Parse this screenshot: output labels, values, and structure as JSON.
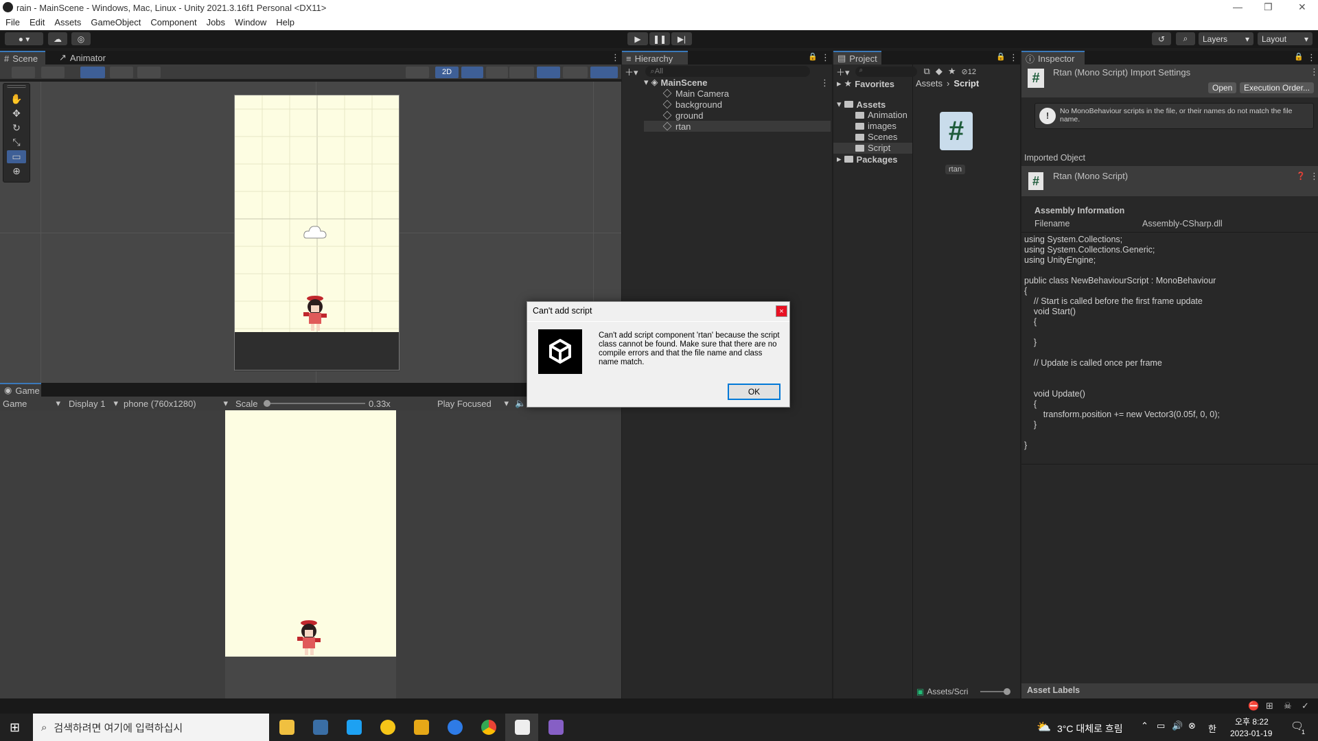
{
  "window": {
    "title": "rain - MainScene - Windows, Mac, Linux - Unity 2021.3.16f1 Personal <DX11>"
  },
  "menu": [
    "File",
    "Edit",
    "Assets",
    "GameObject",
    "Component",
    "Jobs",
    "Window",
    "Help"
  ],
  "toolbar": {
    "layers_label": "Layers",
    "layout_label": "Layout"
  },
  "scene": {
    "tab_scene": "Scene",
    "tab_animator": "Animator",
    "mode_2d": "2D"
  },
  "game": {
    "tab": "Game",
    "view_select": "Game",
    "display_select": "Display 1",
    "resolution_select": "phone (760x1280)",
    "scale_label": "Scale",
    "scale_value": "0.33x",
    "scale_fraction": 0.0,
    "play_mode_select": "Play Focused"
  },
  "hierarchy": {
    "tab": "Hierarchy",
    "search_placeholder": "All",
    "scene_name": "MainScene",
    "items": [
      "Main Camera",
      "background",
      "ground",
      "rtan"
    ]
  },
  "project": {
    "tab": "Project",
    "favorites": "Favorites",
    "assets": "Assets",
    "folders": [
      "Animation",
      "images",
      "Scenes",
      "Script"
    ],
    "packages": "Packages",
    "breadcrumb_root": "Assets",
    "breadcrumb_current": "Script",
    "file_name": "rtan",
    "bottom_path": "Assets/Scri",
    "hidden_count": "12"
  },
  "inspector": {
    "tab": "Inspector",
    "title": "Rtan (Mono Script) Import Settings",
    "open_button": "Open",
    "execution_order_button": "Execution Order...",
    "warning": "No MonoBehaviour scripts in the file, or their names do not match the file name.",
    "imported_object_label": "Imported Object",
    "imported_object_name": "Rtan (Mono Script)",
    "assembly_header": "Assembly Information",
    "filename_label": "Filename",
    "filename_value": "Assembly-CSharp.dll",
    "code": "using System.Collections;\nusing System.Collections.Generic;\nusing UnityEngine;\n\npublic class NewBehaviourScript : MonoBehaviour\n{\n    // Start is called before the first frame update\n    void Start()\n    {\n\n    }\n\n    // Update is called once per frame\n\n\n    void Update()\n    {\n        transform.position += new Vector3(0.05f, 0, 0);\n    }\n\n}",
    "asset_labels": "Asset Labels"
  },
  "dialog": {
    "title": "Can't add script",
    "message": "Can't add script component 'rtan' because the script class cannot be found. Make sure that there are no compile errors and that the file name and class name match.",
    "ok_button": "OK"
  },
  "taskbar": {
    "search_placeholder": "검색하려면 여기에 입력하십시",
    "weather": "3°C  대체로 흐림",
    "ime": "한",
    "time": "오후 8:22",
    "date": "2023-01-19",
    "notification_count": "1"
  },
  "colors": {
    "accent_blue": "#3a79bb",
    "sky": "#fdfde2",
    "panel": "#282828"
  }
}
